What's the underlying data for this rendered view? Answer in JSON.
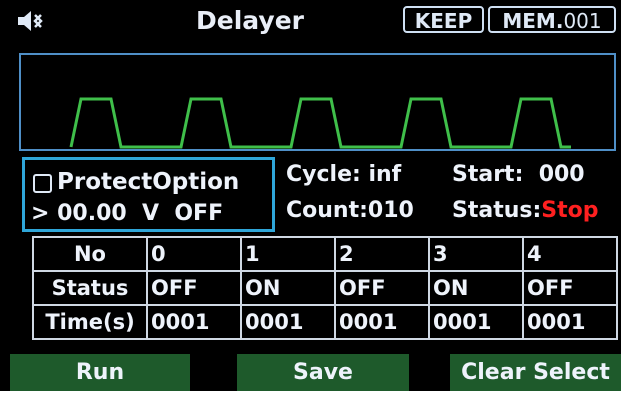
{
  "header": {
    "title": "Delayer",
    "keep_label": "KEEP",
    "mem_label": "MEM.",
    "mem_number": "001",
    "speaker_icon": "speaker-mute-icon"
  },
  "waveform": {
    "pulse_count": 5,
    "color": "#3fbf4a",
    "border_color": "#4f8fc7"
  },
  "protect": {
    "checked": false,
    "label": "ProtectOption",
    "value_text": "> 00.00  V  OFF"
  },
  "info": {
    "cycle": "Cycle: inf",
    "count": "Count:010",
    "start": "Start:  000",
    "status_label": "Status:",
    "status_value": "Stop",
    "status_color": "#ff2020"
  },
  "table": {
    "rows": [
      [
        "No",
        "0",
        "1",
        "2",
        "3",
        "4"
      ],
      [
        "Status",
        "OFF",
        "ON",
        "OFF",
        "ON",
        "OFF"
      ],
      [
        "Time(s)",
        "0001",
        "0001",
        "0001",
        "0001",
        "0001"
      ]
    ]
  },
  "buttons": {
    "run": "Run",
    "save": "Save",
    "clear_select": "Clear Select",
    "color": "#1e5a2b"
  }
}
